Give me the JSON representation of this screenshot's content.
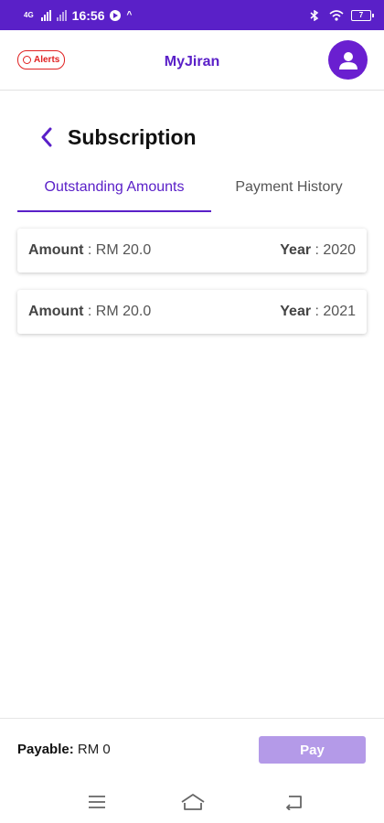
{
  "status_bar": {
    "network": "4G",
    "time": "16:56",
    "battery": "7"
  },
  "header": {
    "alerts_label": "Alerts",
    "app_title": "MyJiran"
  },
  "page": {
    "title": "Subscription"
  },
  "tabs": [
    {
      "label": "Outstanding Amounts",
      "selected": true
    },
    {
      "label": "Payment History",
      "selected": false
    }
  ],
  "outstanding": [
    {
      "amount_label": "Amount",
      "amount_value": ": RM 20.0",
      "year_label": "Year",
      "year_value": ": 2020"
    },
    {
      "amount_label": "Amount",
      "amount_value": ": RM 20.0",
      "year_label": "Year",
      "year_value": ": 2021"
    }
  ],
  "pay_bar": {
    "payable_label": "Payable:",
    "payable_value": "RM 0",
    "pay_button": "Pay"
  },
  "colors": {
    "primary": "#5a20c8",
    "alert_red": "#e02020",
    "pay_disabled": "#b49ae8"
  },
  "icons": {
    "back": "chevron-left-icon",
    "avatar": "person-icon",
    "nav_menu": "menu-icon",
    "nav_home": "home-icon",
    "nav_back": "back-icon"
  }
}
